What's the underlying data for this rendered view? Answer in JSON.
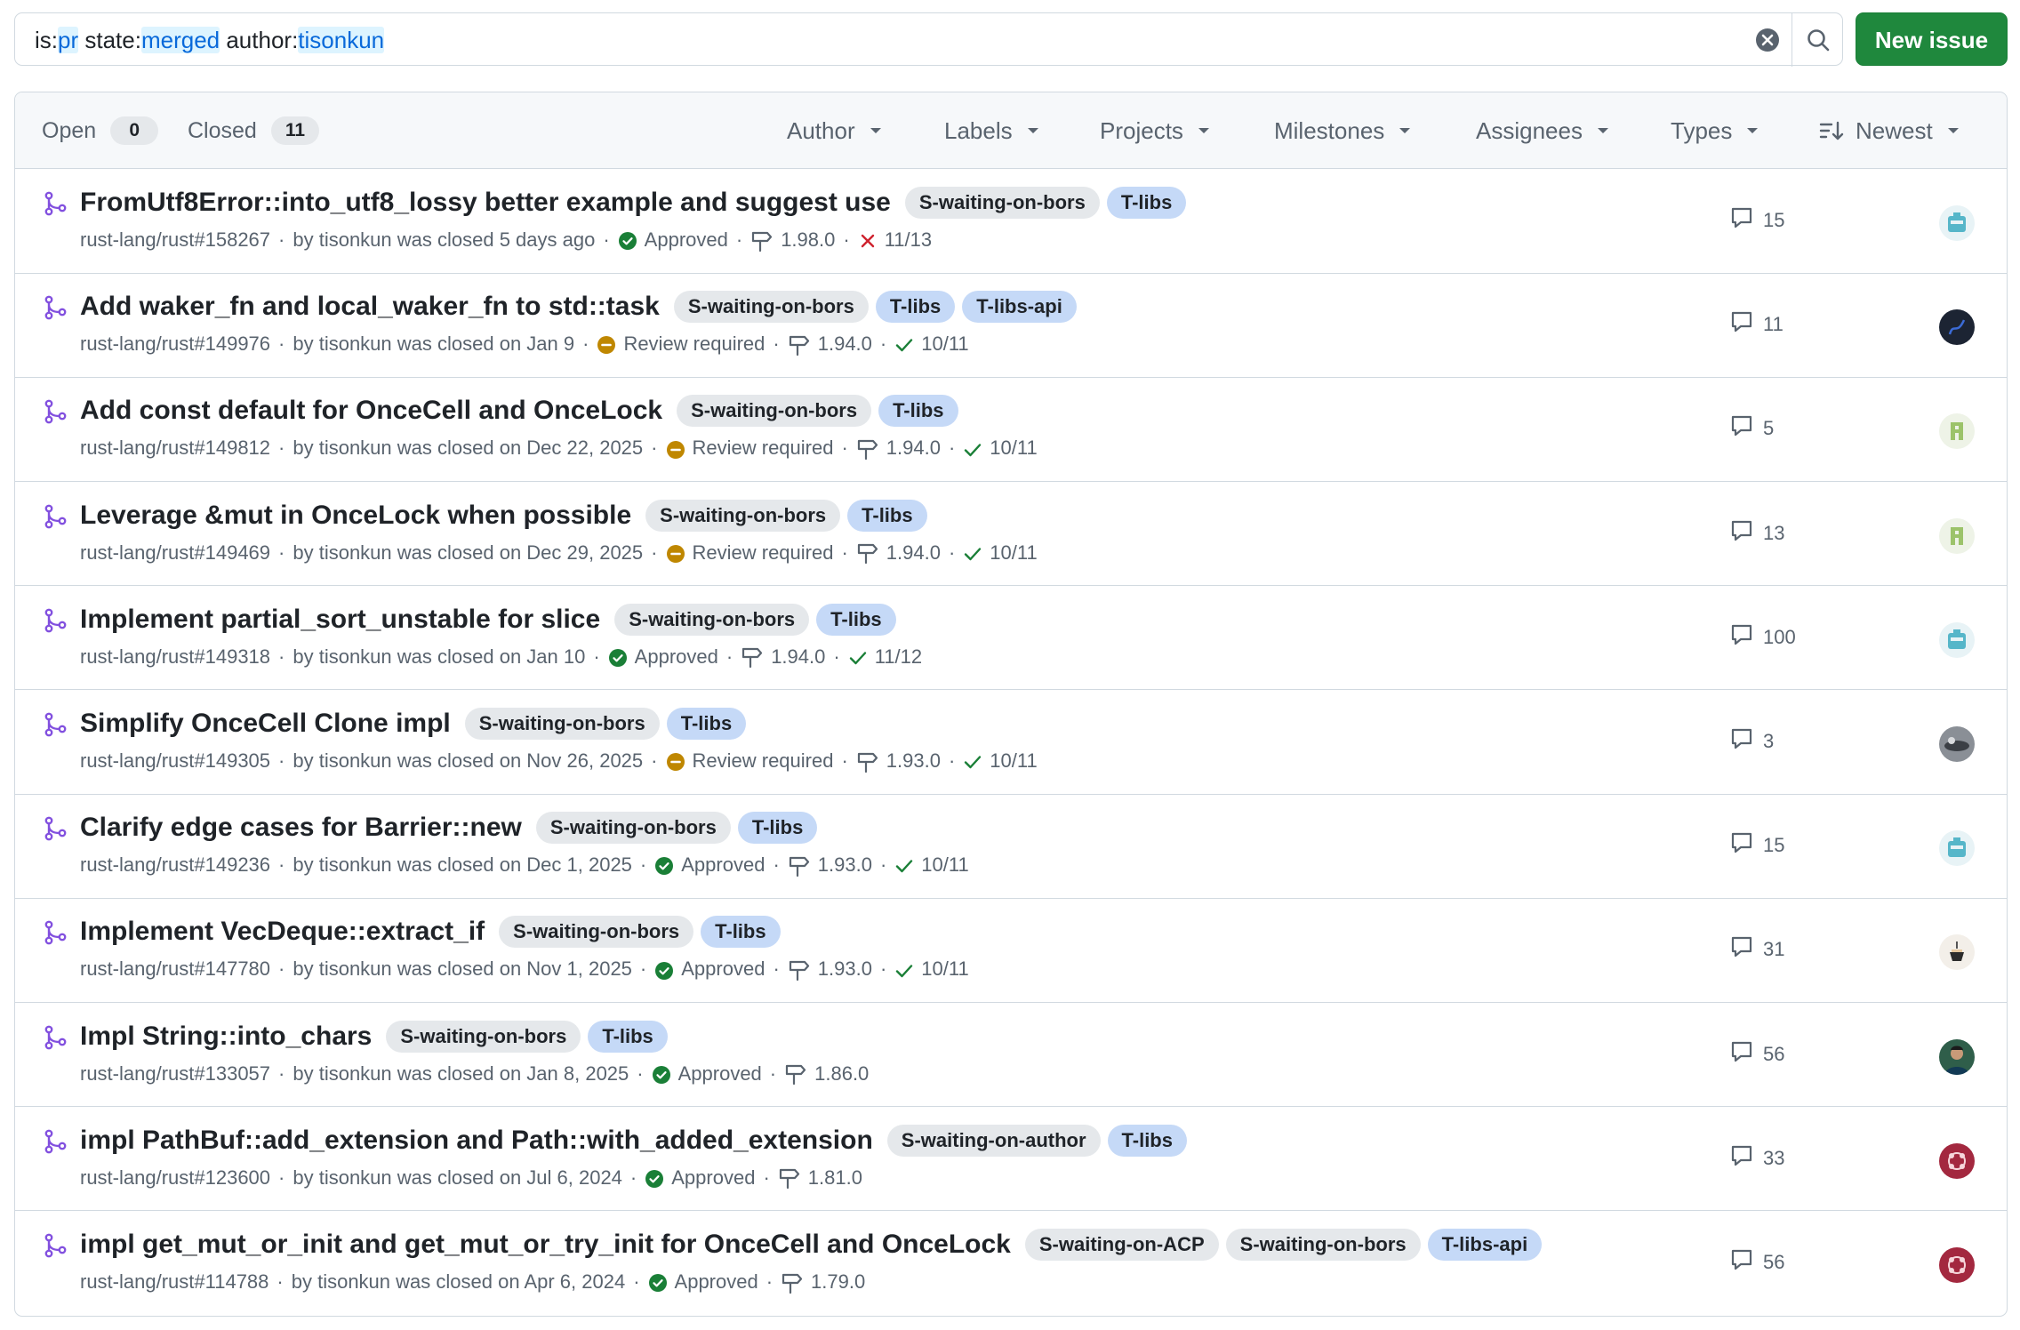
{
  "search": {
    "tokens": [
      {
        "key": "is:",
        "value": "pr"
      },
      {
        "key": "state:",
        "value": "merged"
      },
      {
        "key": "author:",
        "value": "tisonkun"
      }
    ]
  },
  "buttons": {
    "new_issue": "New issue"
  },
  "tabs": {
    "open_label": "Open",
    "open_count": "0",
    "closed_label": "Closed",
    "closed_count": "11"
  },
  "filters": {
    "author": "Author",
    "labels": "Labels",
    "projects": "Projects",
    "milestones": "Milestones",
    "assignees": "Assignees",
    "types": "Types",
    "sort": "Newest"
  },
  "colors": {
    "accent_green": "#1f883d",
    "pr_purple": "#8250df",
    "label_gray": "#e5e8eb",
    "label_blue": "#c5d9f7",
    "status_green": "#1a7f37",
    "status_yellow": "#bf8700",
    "status_red": "#cf222e"
  },
  "rows": [
    {
      "title": "FromUtf8Error::into_utf8_lossy better example and suggest use",
      "labels": [
        {
          "text": "S-waiting-on-bors",
          "kind": "gray"
        },
        {
          "text": "T-libs",
          "kind": "blue"
        }
      ],
      "ref": "rust-lang/rust#158267",
      "closed": "by tisonkun was closed 5 days ago",
      "review": "Approved",
      "review_state": "approved",
      "milestone": "1.98.0",
      "checks": "11/13",
      "checks_state": "fail",
      "comments": "15",
      "avatar": "avatar-teal-robot"
    },
    {
      "title": "Add waker_fn and local_waker_fn to std::task",
      "labels": [
        {
          "text": "S-waiting-on-bors",
          "kind": "gray"
        },
        {
          "text": "T-libs",
          "kind": "blue"
        },
        {
          "text": "T-libs-api",
          "kind": "blue"
        }
      ],
      "ref": "rust-lang/rust#149976",
      "closed": "by tisonkun was closed on Jan 9",
      "review": "Review required",
      "review_state": "required",
      "milestone": "1.94.0",
      "checks": "10/11",
      "checks_state": "pass",
      "comments": "11",
      "avatar": "avatar-dark"
    },
    {
      "title": "Add const default for OnceCell and OnceLock",
      "labels": [
        {
          "text": "S-waiting-on-bors",
          "kind": "gray"
        },
        {
          "text": "T-libs",
          "kind": "blue"
        }
      ],
      "ref": "rust-lang/rust#149812",
      "closed": "by tisonkun was closed on Dec 22, 2025",
      "review": "Review required",
      "review_state": "required",
      "milestone": "1.94.0",
      "checks": "10/11",
      "checks_state": "pass",
      "comments": "5",
      "avatar": "avatar-green-pixel"
    },
    {
      "title": "Leverage &mut in OnceLock when possible",
      "labels": [
        {
          "text": "S-waiting-on-bors",
          "kind": "gray"
        },
        {
          "text": "T-libs",
          "kind": "blue"
        }
      ],
      "ref": "rust-lang/rust#149469",
      "closed": "by tisonkun was closed on Dec 29, 2025",
      "review": "Review required",
      "review_state": "required",
      "milestone": "1.94.0",
      "checks": "10/11",
      "checks_state": "pass",
      "comments": "13",
      "avatar": "avatar-green-pixel"
    },
    {
      "title": "Implement partial_sort_unstable for slice",
      "labels": [
        {
          "text": "S-waiting-on-bors",
          "kind": "gray"
        },
        {
          "text": "T-libs",
          "kind": "blue"
        }
      ],
      "ref": "rust-lang/rust#149318",
      "closed": "by tisonkun was closed on Jan 10",
      "review": "Approved",
      "review_state": "approved",
      "milestone": "1.94.0",
      "checks": "11/12",
      "checks_state": "pass",
      "comments": "100",
      "avatar": "avatar-teal-robot"
    },
    {
      "title": "Simplify OnceCell Clone impl",
      "labels": [
        {
          "text": "S-waiting-on-bors",
          "kind": "gray"
        },
        {
          "text": "T-libs",
          "kind": "blue"
        }
      ],
      "ref": "rust-lang/rust#149305",
      "closed": "by tisonkun was closed on Nov 26, 2025",
      "review": "Review required",
      "review_state": "required",
      "milestone": "1.93.0",
      "checks": "10/11",
      "checks_state": "pass",
      "comments": "3",
      "avatar": "avatar-photo-gray"
    },
    {
      "title": "Clarify edge cases for Barrier::new",
      "labels": [
        {
          "text": "S-waiting-on-bors",
          "kind": "gray"
        },
        {
          "text": "T-libs",
          "kind": "blue"
        }
      ],
      "ref": "rust-lang/rust#149236",
      "closed": "by tisonkun was closed on Dec 1, 2025",
      "review": "Approved",
      "review_state": "approved",
      "milestone": "1.93.0",
      "checks": "10/11",
      "checks_state": "pass",
      "comments": "15",
      "avatar": "avatar-teal-robot"
    },
    {
      "title": "Implement VecDeque::extract_if",
      "labels": [
        {
          "text": "S-waiting-on-bors",
          "kind": "gray"
        },
        {
          "text": "T-libs",
          "kind": "blue"
        }
      ],
      "ref": "rust-lang/rust#147780",
      "closed": "by tisonkun was closed on Nov 1, 2025",
      "review": "Approved",
      "review_state": "approved",
      "milestone": "1.93.0",
      "checks": "10/11",
      "checks_state": "pass",
      "comments": "31",
      "avatar": "avatar-cup"
    },
    {
      "title": "Impl String::into_chars",
      "labels": [
        {
          "text": "S-waiting-on-bors",
          "kind": "gray"
        },
        {
          "text": "T-libs",
          "kind": "blue"
        }
      ],
      "ref": "rust-lang/rust#133057",
      "closed": "by tisonkun was closed on Jan 8, 2025",
      "review": "Approved",
      "review_state": "approved",
      "milestone": "1.86.0",
      "checks": "",
      "checks_state": "none",
      "comments": "56",
      "avatar": "avatar-person"
    },
    {
      "title": "impl PathBuf::add_extension and Path::with_added_extension",
      "labels": [
        {
          "text": "S-waiting-on-author",
          "kind": "gray"
        },
        {
          "text": "T-libs",
          "kind": "blue"
        }
      ],
      "ref": "rust-lang/rust#123600",
      "closed": "by tisonkun was closed on Jul 6, 2024",
      "review": "Approved",
      "review_state": "approved",
      "milestone": "1.81.0",
      "checks": "",
      "checks_state": "none",
      "comments": "33",
      "avatar": "avatar-red-pattern"
    },
    {
      "title": "impl get_mut_or_init and get_mut_or_try_init for OnceCell and OnceLock",
      "labels": [
        {
          "text": "S-waiting-on-ACP",
          "kind": "gray"
        },
        {
          "text": "S-waiting-on-bors",
          "kind": "gray"
        },
        {
          "text": "T-libs-api",
          "kind": "blue"
        }
      ],
      "ref": "rust-lang/rust#114788",
      "closed": "by tisonkun was closed on Apr 6, 2024",
      "review": "Approved",
      "review_state": "approved",
      "milestone": "1.79.0",
      "checks": "",
      "checks_state": "none",
      "comments": "56",
      "avatar": "avatar-red-pattern"
    }
  ]
}
